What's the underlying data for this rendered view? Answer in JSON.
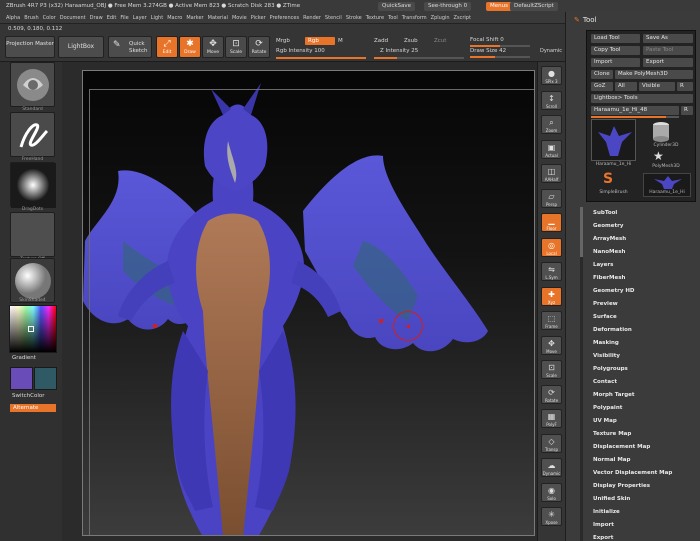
{
  "app": {
    "title": "ZBrush 4R7 P3 (x32)   Haraamud_OBJ   ● Free Mem 3.274GB ● Active Mem 823 ● Scratch Disk 283 ● ZTime",
    "quicksave": "QuickSave",
    "seethrough": "See-through  0",
    "menus": "Menus",
    "script": "DefaultZScript",
    "coords": "0.509, 0.180, 0.112",
    "menu_items": [
      "Alpha",
      "Brush",
      "Color",
      "Document",
      "Draw",
      "Edit",
      "File",
      "Layer",
      "Light",
      "Macro",
      "Marker",
      "Material",
      "Movie",
      "Picker",
      "Preferences",
      "Render",
      "Stencil",
      "Stroke",
      "Texture",
      "Tool",
      "Transform",
      "Zplugin",
      "Zscript"
    ]
  },
  "toolbar": {
    "projection_master": "Projection Master",
    "lightbox": "LightBox",
    "quick_sketch": "Quick Sketch",
    "edit": "Edit",
    "draw": "Draw",
    "move": "Move",
    "scale": "Scale",
    "rotate": "Rotate",
    "mrgb": "Mrgb",
    "rgb": "Rgb",
    "m": "M",
    "rgb_intensity": "Rgb Intensity 100",
    "zadd": "Zadd",
    "zsub": "Zsub",
    "zcut": "Zcut",
    "z_intensity": "Z Intensity 25",
    "focal_shift": "Focal Shift 0",
    "draw_size": "Draw Size 42",
    "dynamic": "Dynamic"
  },
  "left": {
    "brush1": "Standard",
    "brush2": "FreeHand",
    "brush3": "DragDots",
    "brush4": "Texture Off",
    "brush5": "SkinShade4",
    "gradient": "Gradient",
    "switch_color": "SwitchColor",
    "alternate": "Alternate",
    "colors": {
      "main": "#6a4cb8",
      "secondary": "#2f5965"
    }
  },
  "right_shelf": [
    {
      "label": "SPix 3",
      "icon": "sphere-icon",
      "orange": false
    },
    {
      "label": "Scroll",
      "icon": "scroll-icon",
      "orange": false
    },
    {
      "label": "Zoom",
      "icon": "zoom-icon",
      "orange": false
    },
    {
      "label": "Actual",
      "icon": "actual-icon",
      "orange": false
    },
    {
      "label": "AAHalf",
      "icon": "aahalf-icon",
      "orange": false
    },
    {
      "label": "Persp",
      "icon": "persp-icon",
      "orange": false
    },
    {
      "label": "Floor",
      "icon": "floor-icon",
      "orange": true
    },
    {
      "label": "Local",
      "icon": "local-icon",
      "orange": true
    },
    {
      "label": "L.Sym",
      "icon": "lsym-icon",
      "orange": false
    },
    {
      "label": "Xyz",
      "icon": "xyz-icon",
      "orange": true
    },
    {
      "label": "Frame",
      "icon": "frame-icon",
      "orange": false
    },
    {
      "label": "Move",
      "icon": "move-icon",
      "orange": false
    },
    {
      "label": "Scale",
      "icon": "scale-icon",
      "orange": false
    },
    {
      "label": "Rotate",
      "icon": "rotate-icon",
      "orange": false
    },
    {
      "label": "PolyF",
      "icon": "polyf-icon",
      "orange": false
    },
    {
      "label": "Transp",
      "icon": "transp-icon",
      "orange": false
    },
    {
      "label": "Dynamic",
      "icon": "ghost-icon",
      "orange": false
    },
    {
      "label": "Solo",
      "icon": "solo-icon",
      "orange": false
    },
    {
      "label": "Xpose",
      "icon": "xpose-icon",
      "orange": false
    }
  ],
  "tool_panel": {
    "title": "Tool",
    "load_tool": "Load Tool",
    "save_as": "Save As",
    "copy_tool": "Copy Tool",
    "paste_tool": "Paste Tool",
    "import": "Import",
    "export": "Export",
    "clone": "Clone",
    "make_polymesh": "Make PolyMesh3D",
    "goz": "GoZ",
    "all": "All",
    "visible": "Visible",
    "r": "R",
    "lightbox_tools": "Lightbox> Tools",
    "current_tool": "Haraamu_1e_Hi_48",
    "current_tool_r": "R",
    "thumbs": [
      "Haraamu_1e_Hi",
      "Cylinder3D",
      "PolyMesh3D",
      "SimpleBrush",
      "Haraamu_1e_Hi"
    ],
    "menu": [
      "SubTool",
      "Geometry",
      "ArrayMesh",
      "NanoMesh",
      "Layers",
      "FiberMesh",
      "Geometry HD",
      "Preview",
      "Surface",
      "Deformation",
      "Masking",
      "Visibility",
      "Polygroups",
      "Contact",
      "Morph Target",
      "Polypaint",
      "UV Map",
      "Texture Map",
      "Displacement Map",
      "Normal Map",
      "Vector Displacement Map",
      "Display Properties",
      "Unified Skin",
      "Initialize",
      "Import",
      "Export"
    ]
  }
}
